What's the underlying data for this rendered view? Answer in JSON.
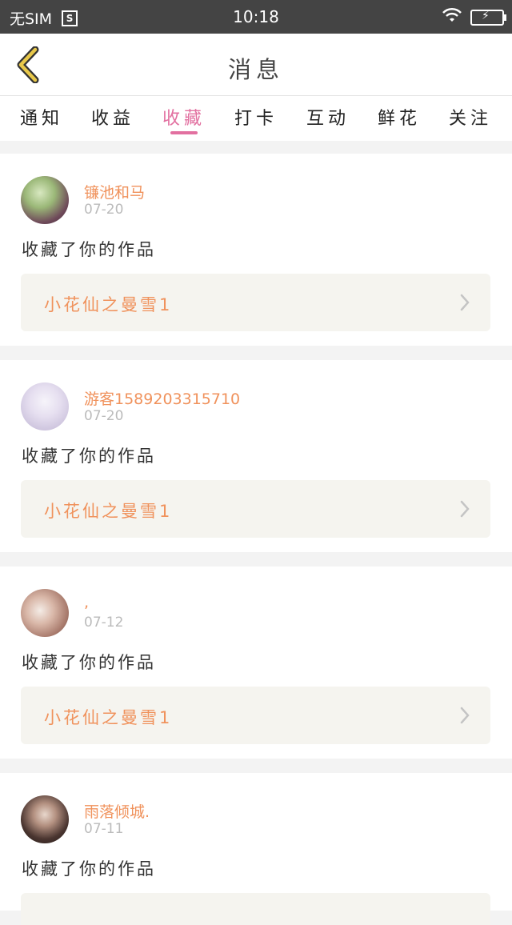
{
  "status_bar": {
    "carrier": "无SIM",
    "time": "10:18"
  },
  "header": {
    "title": "消息"
  },
  "tabs": [
    {
      "label": "通知",
      "active": false
    },
    {
      "label": "收益",
      "active": false
    },
    {
      "label": "收藏",
      "active": true
    },
    {
      "label": "打卡",
      "active": false
    },
    {
      "label": "互动",
      "active": false
    },
    {
      "label": "鲜花",
      "active": false
    },
    {
      "label": "关注",
      "active": false
    }
  ],
  "messages": [
    {
      "username": "镰池和马",
      "date": "07-20",
      "action": "收藏了你的作品",
      "work_title": "小花仙之曼雪1"
    },
    {
      "username": "游客1589203315710",
      "date": "07-20",
      "action": "收藏了你的作品",
      "work_title": "小花仙之曼雪1"
    },
    {
      "username": ",",
      "date": "07-12",
      "action": "收藏了你的作品",
      "work_title": "小花仙之曼雪1"
    },
    {
      "username": "雨落倾城.",
      "date": "07-11",
      "action": "收藏了你的作品",
      "work_title": ""
    }
  ],
  "colors": {
    "accent_pink": "#e270a0",
    "username_orange": "#f0925c",
    "back_icon": "#e8c84a"
  }
}
